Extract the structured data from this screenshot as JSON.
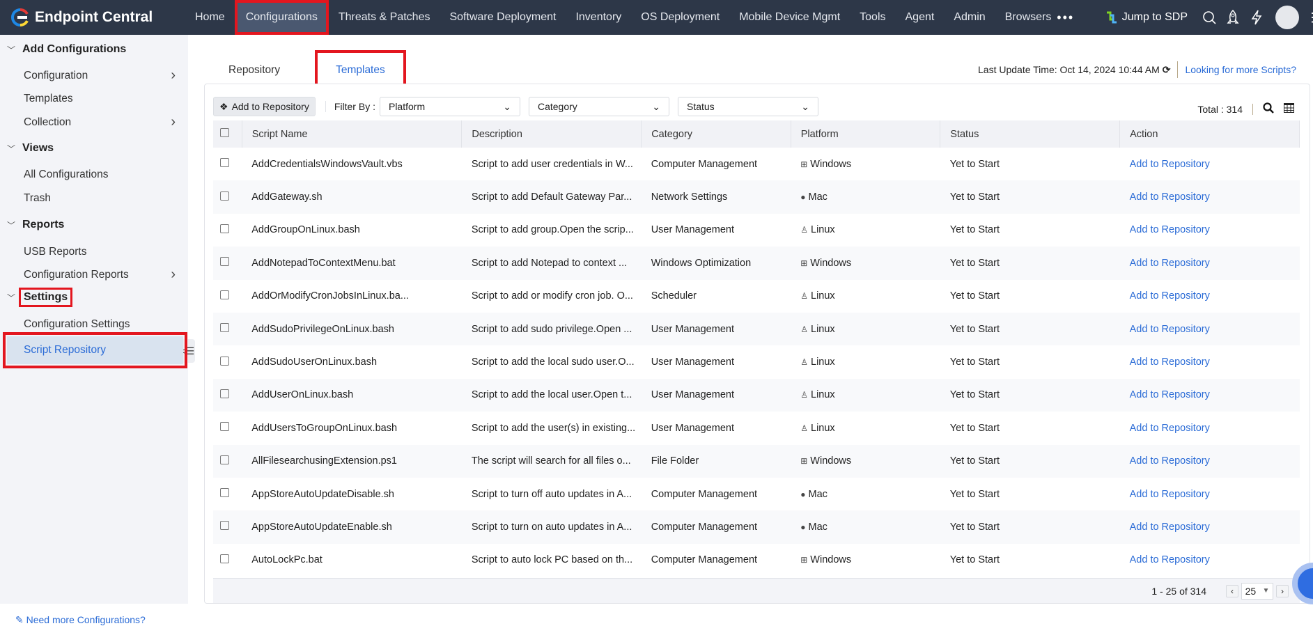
{
  "app": {
    "title": "Endpoint Central"
  },
  "nav": [
    "Home",
    "Configurations",
    "Threats & Patches",
    "Software Deployment",
    "Inventory",
    "OS Deployment",
    "Mobile Device Mgmt",
    "Tools",
    "Agent",
    "Admin",
    "Browsers"
  ],
  "nav_active": "Configurations",
  "header_right": {
    "jump": "Jump to SDP"
  },
  "sidebar": {
    "sections": [
      {
        "title": "Add Configurations",
        "items": [
          {
            "label": "Configuration",
            "arrow": true
          },
          {
            "label": "Templates"
          },
          {
            "label": "Collection",
            "arrow": true
          }
        ]
      },
      {
        "title": "Views",
        "items": [
          {
            "label": "All Configurations"
          },
          {
            "label": "Trash"
          }
        ]
      },
      {
        "title": "Reports",
        "items": [
          {
            "label": "USB Reports"
          },
          {
            "label": "Configuration Reports",
            "arrow": true
          }
        ]
      },
      {
        "title": "Settings",
        "items": [
          {
            "label": "Configuration Settings"
          },
          {
            "label": "Script Repository",
            "active": true
          }
        ]
      }
    ],
    "need_more": "Need more Configurations?"
  },
  "tabs": [
    "Repository",
    "Templates"
  ],
  "last_update": "Last Update Time: Oct 14, 2024 10:44 AM",
  "more_scripts": "Looking for more Scripts?",
  "toolbar": {
    "add": "Add to Repository",
    "filter_by": "Filter By :",
    "filters": [
      "Platform",
      "Category",
      "Status"
    ],
    "total": "Total : 314"
  },
  "columns": [
    "Script Name",
    "Description",
    "Category",
    "Platform",
    "Status",
    "Action"
  ],
  "rows": [
    [
      "AddCredentialsWindowsVault.vbs",
      "Script to add user credentials in W...",
      "Computer Management",
      "Windows",
      "Yet to Start",
      "Add to Repository"
    ],
    [
      "AddGateway.sh",
      "Script to add Default Gateway Par...",
      "Network Settings",
      "Mac",
      "Yet to Start",
      "Add to Repository"
    ],
    [
      "AddGroupOnLinux.bash",
      "Script to add group.Open the scrip...",
      "User Management",
      "Linux",
      "Yet to Start",
      "Add to Repository"
    ],
    [
      "AddNotepadToContextMenu.bat",
      "Script to add Notepad to context ...",
      "Windows Optimization",
      "Windows",
      "Yet to Start",
      "Add to Repository"
    ],
    [
      "AddOrModifyCronJobsInLinux.ba...",
      "Script to add or modify cron job. O...",
      "Scheduler",
      "Linux",
      "Yet to Start",
      "Add to Repository"
    ],
    [
      "AddSudoPrivilegeOnLinux.bash",
      "Script to add sudo privilege.Open ...",
      "User Management",
      "Linux",
      "Yet to Start",
      "Add to Repository"
    ],
    [
      "AddSudoUserOnLinux.bash",
      "Script to add the local sudo user.O...",
      "User Management",
      "Linux",
      "Yet to Start",
      "Add to Repository"
    ],
    [
      "AddUserOnLinux.bash",
      "Script to add the local user.Open t...",
      "User Management",
      "Linux",
      "Yet to Start",
      "Add to Repository"
    ],
    [
      "AddUsersToGroupOnLinux.bash",
      "Script to add the user(s) in existing...",
      "User Management",
      "Linux",
      "Yet to Start",
      "Add to Repository"
    ],
    [
      "AllFilesearchusingExtension.ps1",
      "The script will search for all files o...",
      "File Folder",
      "Windows",
      "Yet to Start",
      "Add to Repository"
    ],
    [
      "AppStoreAutoUpdateDisable.sh",
      "Script to turn off auto updates in A...",
      "Computer Management",
      "Mac",
      "Yet to Start",
      "Add to Repository"
    ],
    [
      "AppStoreAutoUpdateEnable.sh",
      "Script to turn on auto updates in A...",
      "Computer Management",
      "Mac",
      "Yet to Start",
      "Add to Repository"
    ],
    [
      "AutoLockPc.bat",
      "Script to auto lock PC based on th...",
      "Computer Management",
      "Windows",
      "Yet to Start",
      "Add to Repository"
    ]
  ],
  "pagination": {
    "range": "1 - 25 of 314",
    "per_page": "25"
  }
}
